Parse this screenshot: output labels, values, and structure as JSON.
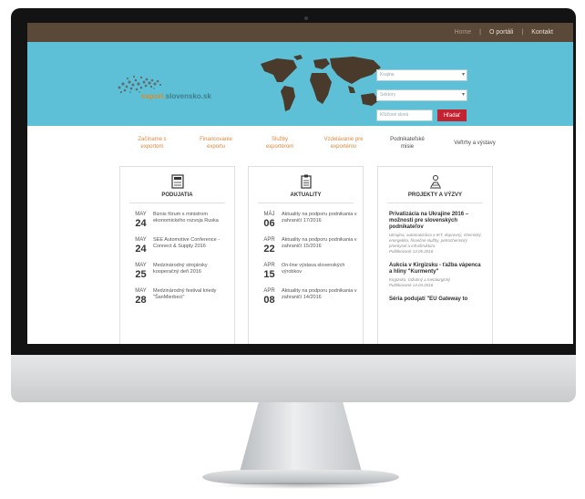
{
  "topbar": {
    "items": [
      {
        "label": "Home",
        "active": true
      },
      {
        "label": "O portáli",
        "active": false
      },
      {
        "label": "Kontakt",
        "active": false
      }
    ],
    "separator": "|"
  },
  "logo": {
    "accent": "export.",
    "text": "slovensko.sk"
  },
  "search": {
    "select1_placeholder": "Krajina",
    "select2_placeholder": "Sektory",
    "input_placeholder": "Kľúčové slová",
    "button_label": "Hľadať"
  },
  "menu": {
    "items": [
      {
        "line1": "Začíname s",
        "line2": "exportom"
      },
      {
        "line1": "Financovanie",
        "line2": "exportu"
      },
      {
        "line1": "Služby",
        "line2": "exportérom"
      },
      {
        "line1": "Vzdelávanie pre",
        "line2": "exportérov"
      },
      {
        "line1": "Podnikateľské",
        "line2": "misie"
      },
      {
        "line1": "Veľtrhy a výstavy",
        "line2": ""
      }
    ]
  },
  "cards": {
    "events": {
      "title": "PODUJATIA",
      "items": [
        {
          "month": "MAY",
          "day": "24",
          "text": "Biznis fórum s ministrom ekonomického rozvoja Ruska"
        },
        {
          "month": "MAY",
          "day": "24",
          "text": "SEE Automotive Conference - Connect & Supply 2016"
        },
        {
          "month": "MAY",
          "day": "25",
          "text": "Medzinárodný strojársky kooperačný deň 2016"
        },
        {
          "month": "MAY",
          "day": "28",
          "text": "Medzinárodný festival kriedy \"ŠanMierbeci\""
        }
      ]
    },
    "news": {
      "title": "AKTUALITY",
      "items": [
        {
          "month": "MÁJ",
          "day": "06",
          "text": "Aktuality na podporu podnikania v zahraničí 17/2016"
        },
        {
          "month": "APR",
          "day": "22",
          "text": "Aktuality na podporu podnikania v zahraničí 15/2016"
        },
        {
          "month": "APR",
          "day": "15",
          "text": "On-line výstava slovenských výrobkov"
        },
        {
          "month": "APR",
          "day": "08",
          "text": "Aktuality na podporu podnikania v zahraničí 14/2016"
        }
      ]
    },
    "projects": {
      "title": "PROJEKTY A VÝZVY",
      "items": [
        {
          "title": "Privatizácia na Ukrajine 2016 – možnosti pre slovenských podnikateľov",
          "desc": "Ukrajina, automatizácia a IKT, dopravný, chemický, energetika, finančné služby, petrochemický priemysel a infraštruktúra",
          "date": "Publikované 13.05.2016"
        },
        {
          "title": "Aukcia v Kirgizsku - ťažba vápenca a hliny \"Kurmenty\"",
          "desc": "Kirgizsko, ťažobný a metalurgický",
          "date": "Publikované 14.04.2016"
        },
        {
          "title": "Séria podujatí \"EU Gateway to",
          "desc": "",
          "date": ""
        }
      ]
    }
  },
  "colors": {
    "topbar": "#5a4939",
    "hero": "#5ec0d6",
    "menu_accent": "#e08840",
    "search_button": "#c5222f"
  }
}
